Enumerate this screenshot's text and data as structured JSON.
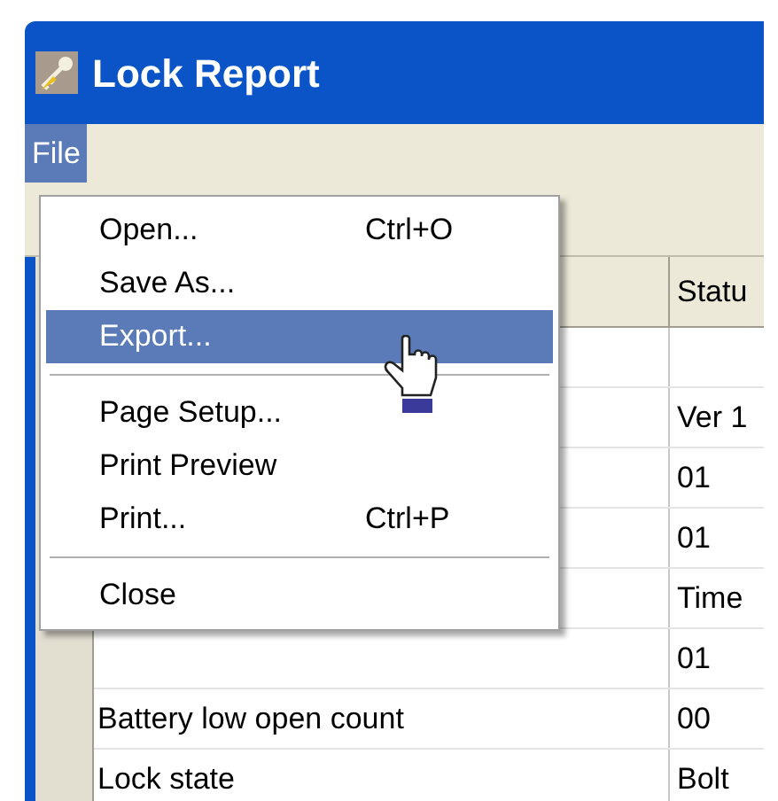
{
  "window": {
    "title": "Lock Report"
  },
  "menu_bar": [
    {
      "label": "File",
      "selected": true
    }
  ],
  "file_menu": [
    {
      "kind": "item",
      "label": "Open...",
      "shortcut": "Ctrl+O",
      "selected": false
    },
    {
      "kind": "item",
      "label": "Save As...",
      "selected": false
    },
    {
      "kind": "item",
      "label": "Export...",
      "selected": true
    },
    {
      "kind": "separator"
    },
    {
      "kind": "item",
      "label": "Page Setup...",
      "selected": false
    },
    {
      "kind": "item",
      "label": "Print Preview",
      "selected": false
    },
    {
      "kind": "item",
      "label": "Print...",
      "shortcut": "Ctrl+P",
      "selected": false
    },
    {
      "kind": "separator"
    },
    {
      "kind": "item",
      "label": "Close",
      "selected": false
    }
  ],
  "table": {
    "columns": [
      "Statu"
    ],
    "rows": [
      {},
      {
        "status": "Ver 1"
      },
      {
        "status": "01"
      },
      {
        "status": "01"
      },
      {
        "status": "Time"
      },
      {
        "status": "01"
      },
      {
        "label": "Battery low open count",
        "status": "00"
      },
      {
        "label": "Lock state",
        "status": "Bolt"
      }
    ]
  }
}
